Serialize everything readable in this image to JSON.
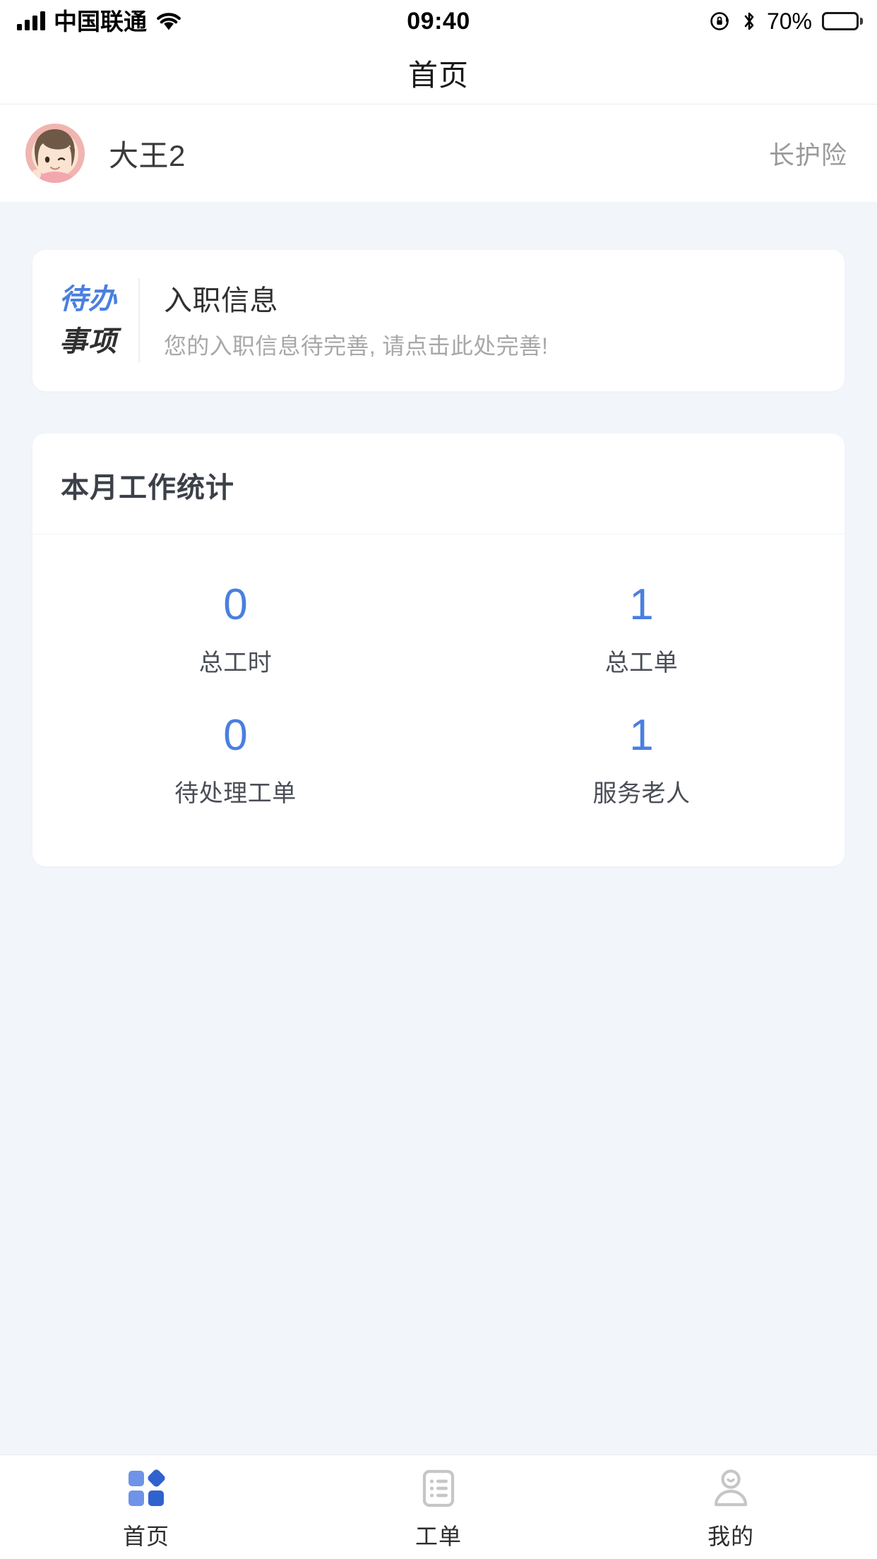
{
  "status_bar": {
    "carrier": "中国联通",
    "time": "09:40",
    "battery_percent": "70%",
    "signal_icon": "signal-bars-icon",
    "wifi_icon": "wifi-icon",
    "rotation_lock_icon": "rotation-lock-icon",
    "bluetooth_icon": "bluetooth-icon",
    "battery_icon": "battery-icon",
    "battery_fill_ratio": 70
  },
  "nav": {
    "title": "首页"
  },
  "profile": {
    "name": "大王2",
    "tag": "长护险",
    "avatar_icon": "user-avatar-girl-icon"
  },
  "todo": {
    "badge_line1": "待办",
    "badge_line2": "事项",
    "title": "入职信息",
    "subtitle": "您的入职信息待完善, 请点击此处完善!"
  },
  "stats": {
    "title": "本月工作统计",
    "items": [
      {
        "value": "0",
        "label": "总工时"
      },
      {
        "value": "1",
        "label": "总工单"
      },
      {
        "value": "0",
        "label": "待处理工单"
      },
      {
        "value": "1",
        "label": "服务老人"
      }
    ]
  },
  "tab_bar": {
    "items": [
      {
        "label": "首页",
        "icon": "grid-home-icon",
        "active": true
      },
      {
        "label": "工单",
        "icon": "list-document-icon",
        "active": false
      },
      {
        "label": "我的",
        "icon": "person-icon",
        "active": false
      }
    ]
  },
  "colors": {
    "accent_blue": "#4a7fe0",
    "page_background": "#f2f6fb",
    "card_background": "#ffffff",
    "muted_text": "#a8a8a8",
    "tab_inactive": "#c6c6c6"
  }
}
